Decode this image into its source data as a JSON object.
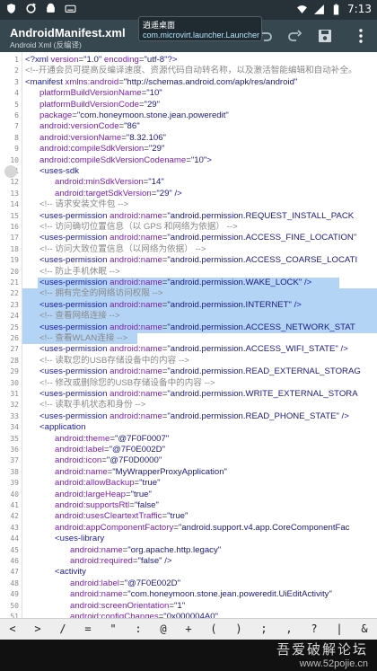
{
  "status_bar": {
    "time": "7:13",
    "left_icons": [
      "shield-icon",
      "sync-icon",
      "android-debug-icon",
      "keyboard-icon"
    ],
    "right_icons": [
      "wifi-icon",
      "signal-icon",
      "battery-icon"
    ]
  },
  "toolbar": {
    "title": "AndroidManifest.xml",
    "subtitle": "Android Xml (反编译)",
    "icons": [
      "undo-icon",
      "redo-icon",
      "save-icon",
      "more-vert-icon"
    ]
  },
  "popup": {
    "label": "逍遥桌面",
    "package": "com.microvirt.launcher.Launcher"
  },
  "editor": {
    "lines": [
      {
        "n": "1",
        "indent": 0,
        "parts": [
          [
            "tag",
            "<?xml "
          ],
          [
            "attr",
            "version"
          ],
          [
            "eq",
            "="
          ],
          [
            "val",
            "\"1.0\" "
          ],
          [
            "attr",
            "encoding"
          ],
          [
            "eq",
            "="
          ],
          [
            "val",
            "\"utf-8\""
          ],
          [
            "tag",
            "?>"
          ]
        ]
      },
      {
        "n": "2",
        "indent": 0,
        "parts": [
          [
            "cmt",
            "<!--开通会员可提高反编译速度、资源代码自动转名称，以及激活智能编辑和自动补全。"
          ]
        ]
      },
      {
        "n": "3",
        "indent": 0,
        "parts": [
          [
            "tag",
            "<manifest "
          ],
          [
            "attr",
            "xmlns:android"
          ],
          [
            "eq",
            "="
          ],
          [
            "val",
            "\"http://schemas.android.com/apk/res/android\""
          ]
        ]
      },
      {
        "n": "4",
        "indent": 1,
        "parts": [
          [
            "attr",
            "platformBuildVersionName"
          ],
          [
            "eq",
            "="
          ],
          [
            "val",
            "\"10\""
          ]
        ]
      },
      {
        "n": "5",
        "indent": 1,
        "parts": [
          [
            "attr",
            "platformBuildVersionCode"
          ],
          [
            "eq",
            "="
          ],
          [
            "val",
            "\"29\""
          ]
        ]
      },
      {
        "n": "6",
        "indent": 1,
        "parts": [
          [
            "attr",
            "package"
          ],
          [
            "eq",
            "="
          ],
          [
            "val",
            "\"com.honeymoon.stone.jean.poweredit\""
          ]
        ]
      },
      {
        "n": "7",
        "indent": 1,
        "parts": [
          [
            "attr",
            "android:versionCode"
          ],
          [
            "eq",
            "="
          ],
          [
            "val",
            "\"86\""
          ]
        ]
      },
      {
        "n": "8",
        "indent": 1,
        "parts": [
          [
            "attr",
            "android:versionName"
          ],
          [
            "eq",
            "="
          ],
          [
            "val",
            "\"8.32.106\""
          ]
        ]
      },
      {
        "n": "9",
        "indent": 1,
        "parts": [
          [
            "attr",
            "android:compileSdkVersion"
          ],
          [
            "eq",
            "="
          ],
          [
            "val",
            "\"29\""
          ]
        ]
      },
      {
        "n": "10",
        "indent": 1,
        "parts": [
          [
            "attr",
            "android:compileSdkVersionCodename"
          ],
          [
            "eq",
            "="
          ],
          [
            "val",
            "\"10\""
          ],
          [
            "tag",
            ">"
          ]
        ]
      },
      {
        "n": "11",
        "indent": 1,
        "parts": [
          [
            "tag",
            "<uses-sdk"
          ]
        ]
      },
      {
        "n": "12",
        "indent": 2,
        "parts": [
          [
            "attr",
            "android:minSdkVersion"
          ],
          [
            "eq",
            "="
          ],
          [
            "val",
            "\"14\""
          ]
        ]
      },
      {
        "n": "13",
        "indent": 2,
        "parts": [
          [
            "attr",
            "android:targetSdkVersion"
          ],
          [
            "eq",
            "="
          ],
          [
            "val",
            "\"29\" "
          ],
          [
            "tag",
            "/>"
          ]
        ]
      },
      {
        "n": "14",
        "indent": 1,
        "parts": [
          [
            "cmt",
            "<!-- 请求安装文件包 -->"
          ]
        ]
      },
      {
        "n": "15",
        "indent": 1,
        "parts": [
          [
            "tag",
            "<uses-permission "
          ],
          [
            "attr",
            "android:name"
          ],
          [
            "eq",
            "="
          ],
          [
            "val",
            "\"android.permission.REQUEST_INSTALL_PACK"
          ]
        ]
      },
      {
        "n": "16",
        "indent": 1,
        "parts": [
          [
            "cmt",
            "<!-- 访问确切位置信息（以 GPS 和网络为依据） -->"
          ]
        ]
      },
      {
        "n": "17",
        "indent": 1,
        "parts": [
          [
            "tag",
            "<uses-permission "
          ],
          [
            "attr",
            "android:name"
          ],
          [
            "eq",
            "="
          ],
          [
            "val",
            "\"android.permission.ACCESS_FINE_LOCATION\""
          ]
        ]
      },
      {
        "n": "18",
        "indent": 1,
        "parts": [
          [
            "cmt",
            "<!-- 访问大致位置信息（以网络为依据） -->"
          ]
        ]
      },
      {
        "n": "19",
        "indent": 1,
        "parts": [
          [
            "tag",
            "<uses-permission "
          ],
          [
            "attr",
            "android:name"
          ],
          [
            "eq",
            "="
          ],
          [
            "val",
            "\"android.permission.ACCESS_COARSE_LOCATI"
          ]
        ]
      },
      {
        "n": "20",
        "indent": 1,
        "parts": [
          [
            "cmt",
            "<!-- 防止手机休眠 -->"
          ]
        ]
      },
      {
        "n": "21",
        "indent": 1,
        "sel": "partial",
        "parts": [
          [
            "tag",
            "<uses-permission "
          ],
          [
            "attr",
            "android:name"
          ],
          [
            "eq",
            "="
          ],
          [
            "val",
            "\"android.permission.WAKE_LOCK\" "
          ],
          [
            "tag",
            "/>"
          ]
        ]
      },
      {
        "n": "22",
        "indent": 1,
        "sel": "full",
        "parts": [
          [
            "cmt",
            "<!-- 拥有完全的网络访问权限 -->"
          ]
        ]
      },
      {
        "n": "23",
        "indent": 1,
        "sel": "full",
        "parts": [
          [
            "tag",
            "<uses-permission "
          ],
          [
            "attr",
            "android:name"
          ],
          [
            "eq",
            "="
          ],
          [
            "val",
            "\"android.permission.INTERNET\" "
          ],
          [
            "tag",
            "/>"
          ]
        ]
      },
      {
        "n": "24",
        "indent": 1,
        "sel": "full",
        "parts": [
          [
            "cmt",
            "<!-- 查看网络连接 -->"
          ]
        ]
      },
      {
        "n": "25",
        "indent": 1,
        "sel": "full",
        "parts": [
          [
            "tag",
            "<uses-permission "
          ],
          [
            "attr",
            "android:name"
          ],
          [
            "eq",
            "="
          ],
          [
            "val",
            "\"android.permission.ACCESS_NETWORK_STAT"
          ]
        ]
      },
      {
        "n": "26",
        "indent": 1,
        "sel": "partial2",
        "parts": [
          [
            "cmt",
            "<!-- 查看WLAN连接 -->"
          ]
        ]
      },
      {
        "n": "27",
        "indent": 1,
        "parts": [
          [
            "tag",
            "<uses-permission "
          ],
          [
            "attr",
            "android:name"
          ],
          [
            "eq",
            "="
          ],
          [
            "val",
            "\"android.permission.ACCESS_WIFI_STATE\" "
          ],
          [
            "tag",
            "/>"
          ]
        ]
      },
      {
        "n": "28",
        "indent": 1,
        "parts": [
          [
            "cmt",
            "<!-- 读取您的USB存储设备中的内容 -->"
          ]
        ]
      },
      {
        "n": "29",
        "indent": 1,
        "parts": [
          [
            "tag",
            "<uses-permission "
          ],
          [
            "attr",
            "android:name"
          ],
          [
            "eq",
            "="
          ],
          [
            "val",
            "\"android.permission.READ_EXTERNAL_STORAG"
          ]
        ]
      },
      {
        "n": "30",
        "indent": 1,
        "parts": [
          [
            "cmt",
            "<!-- 修改或删除您的USB存储设备中的内容 -->"
          ]
        ]
      },
      {
        "n": "31",
        "indent": 1,
        "parts": [
          [
            "tag",
            "<uses-permission "
          ],
          [
            "attr",
            "android:name"
          ],
          [
            "eq",
            "="
          ],
          [
            "val",
            "\"android.permission.WRITE_EXTERNAL_STORA"
          ]
        ]
      },
      {
        "n": "32",
        "indent": 1,
        "parts": [
          [
            "cmt",
            "<!-- 读取手机状态和身份 -->"
          ]
        ]
      },
      {
        "n": "33",
        "indent": 1,
        "parts": [
          [
            "tag",
            "<uses-permission "
          ],
          [
            "attr",
            "android:name"
          ],
          [
            "eq",
            "="
          ],
          [
            "val",
            "\"android.permission.READ_PHONE_STATE\" "
          ],
          [
            "tag",
            "/>"
          ]
        ]
      },
      {
        "n": "34",
        "indent": 1,
        "parts": [
          [
            "tag",
            "<application"
          ]
        ]
      },
      {
        "n": "35",
        "indent": 2,
        "parts": [
          [
            "attr",
            "android:theme"
          ],
          [
            "eq",
            "="
          ],
          [
            "val",
            "\"@7F0F0007\""
          ]
        ]
      },
      {
        "n": "36",
        "indent": 2,
        "parts": [
          [
            "attr",
            "android:label"
          ],
          [
            "eq",
            "="
          ],
          [
            "val",
            "\"@7F0E002D\""
          ]
        ]
      },
      {
        "n": "37",
        "indent": 2,
        "parts": [
          [
            "attr",
            "android:icon"
          ],
          [
            "eq",
            "="
          ],
          [
            "val",
            "\"@7F0D0000\""
          ]
        ]
      },
      {
        "n": "38",
        "indent": 2,
        "parts": [
          [
            "attr",
            "android:name"
          ],
          [
            "eq",
            "="
          ],
          [
            "val",
            "\"MyWrapperProxyApplication\""
          ]
        ]
      },
      {
        "n": "39",
        "indent": 2,
        "parts": [
          [
            "attr",
            "android:allowBackup"
          ],
          [
            "eq",
            "="
          ],
          [
            "val",
            "\"true\""
          ]
        ]
      },
      {
        "n": "40",
        "indent": 2,
        "parts": [
          [
            "attr",
            "android:largeHeap"
          ],
          [
            "eq",
            "="
          ],
          [
            "val",
            "\"true\""
          ]
        ]
      },
      {
        "n": "41",
        "indent": 2,
        "parts": [
          [
            "attr",
            "android:supportsRtl"
          ],
          [
            "eq",
            "="
          ],
          [
            "val",
            "\"false\""
          ]
        ]
      },
      {
        "n": "42",
        "indent": 2,
        "parts": [
          [
            "attr",
            "android:usesCleartextTraffic"
          ],
          [
            "eq",
            "="
          ],
          [
            "val",
            "\"true\""
          ]
        ]
      },
      {
        "n": "43",
        "indent": 2,
        "parts": [
          [
            "attr",
            "android:appComponentFactory"
          ],
          [
            "eq",
            "="
          ],
          [
            "val",
            "\"android.support.v4.app.CoreComponentFac"
          ]
        ]
      },
      {
        "n": "44",
        "indent": 2,
        "parts": [
          [
            "tag",
            "<uses-library"
          ]
        ]
      },
      {
        "n": "45",
        "indent": 3,
        "parts": [
          [
            "attr",
            "android:name"
          ],
          [
            "eq",
            "="
          ],
          [
            "val",
            "\"org.apache.http.legacy\""
          ]
        ]
      },
      {
        "n": "46",
        "indent": 3,
        "parts": [
          [
            "attr",
            "android:required"
          ],
          [
            "eq",
            "="
          ],
          [
            "val",
            "\"false\" "
          ],
          [
            "tag",
            "/>"
          ]
        ]
      },
      {
        "n": "47",
        "indent": 2,
        "parts": [
          [
            "tag",
            "<activity"
          ]
        ]
      },
      {
        "n": "48",
        "indent": 3,
        "parts": [
          [
            "attr",
            "android:label"
          ],
          [
            "eq",
            "="
          ],
          [
            "val",
            "\"@7F0E002D\""
          ]
        ]
      },
      {
        "n": "49",
        "indent": 3,
        "parts": [
          [
            "attr",
            "android:name"
          ],
          [
            "eq",
            "="
          ],
          [
            "val",
            "\"com.honeymoon.stone.jean.poweredit.UiEditActivity\""
          ]
        ]
      },
      {
        "n": "50",
        "indent": 3,
        "parts": [
          [
            "attr",
            "android:screenOrientation"
          ],
          [
            "eq",
            "="
          ],
          [
            "val",
            "\"1\""
          ]
        ]
      },
      {
        "n": "51",
        "indent": 3,
        "parts": [
          [
            "attr",
            "android:configChanges"
          ],
          [
            "eq",
            "="
          ],
          [
            "val",
            "\"0x000004A0\""
          ]
        ]
      }
    ]
  },
  "key_bar": {
    "keys": [
      "<",
      ">",
      "/",
      "=",
      "\"",
      ":",
      "@",
      "+",
      "(",
      ")",
      ";",
      ",",
      "?",
      "|",
      "&"
    ]
  },
  "watermark": {
    "line1": "吾爱破解论坛",
    "line2": "www.52pojie.cn"
  }
}
